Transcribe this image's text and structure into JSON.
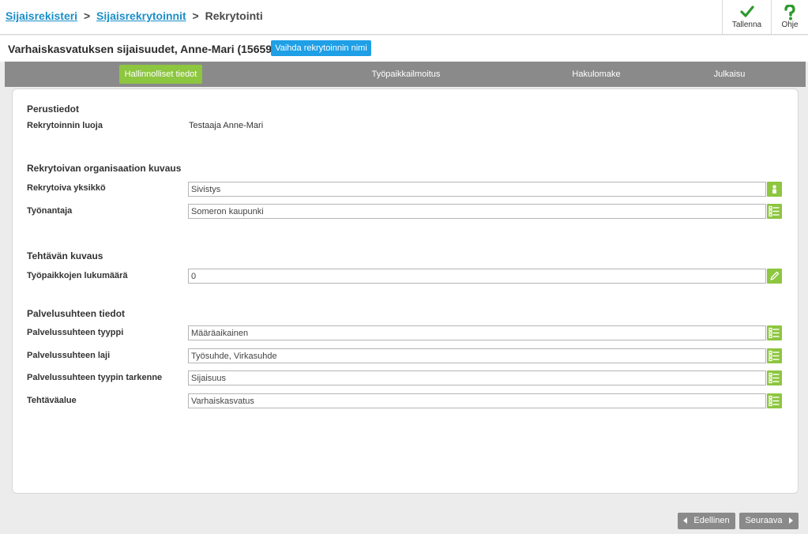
{
  "breadcrumb": {
    "item1": "Sijaisrekisteri",
    "sep1": ">",
    "item2": "Sijaisrekrytoinnit",
    "sep2": ">",
    "current": "Rekrytointi"
  },
  "toolbar": {
    "save_label": "Tallenna",
    "help_label": "Ohje"
  },
  "page": {
    "title": "Varhaiskasvatuksen sijaisuudet, Anne-Mari (15659)",
    "rename_button": "Vaihda rekrytoinnin nimi"
  },
  "tabs": [
    {
      "label": "Hallinnolliset tiedot",
      "active": true
    },
    {
      "label": "Työpaikkailmoitus",
      "active": false
    },
    {
      "label": "Hakulomake",
      "active": false
    },
    {
      "label": "Julkaisu",
      "active": false
    }
  ],
  "sections": {
    "basic": {
      "title": "Perustiedot",
      "creator_label": "Rekrytoinnin luoja",
      "creator_value": "Testaaja Anne-Mari"
    },
    "org": {
      "title": "Rekrytoivan organisaation kuvaus",
      "unit_label": "Rekrytoiva yksikkö",
      "unit_value": "Sivistys",
      "employer_label": "Työnantaja",
      "employer_value": "Someron kaupunki"
    },
    "task": {
      "title": "Tehtävän kuvaus",
      "count_label": "Työpaikkojen lukumäärä",
      "count_value": "0"
    },
    "employment": {
      "title": "Palvelusuhteen tiedot",
      "type_label": "Palvelussuhteen tyyppi",
      "type_value": "Määräaikainen",
      "kind_label": "Palvelussuhteen laji",
      "kind_value": "Työsuhde, Virkasuhde",
      "spec_label": "Palvelussuhteen tyypin tarkenne",
      "spec_value": "Sijaisuus",
      "area_label": "Tehtäväalue",
      "area_value": "Varhaiskasvatus"
    }
  },
  "nav": {
    "prev_label": "Edellinen",
    "next_label": "Seuraava"
  },
  "colors": {
    "accent_green": "#8dc63f",
    "link_blue": "#1a8fc9",
    "button_blue": "#1e9fe6",
    "tabbar_gray": "#8a8a8a"
  },
  "icons": {
    "save": "checkmark-icon",
    "help": "question-icon",
    "person": "person-icon",
    "list": "list-icon",
    "edit": "pencil-icon",
    "prev": "caret-left-icon",
    "next": "caret-right-icon"
  }
}
